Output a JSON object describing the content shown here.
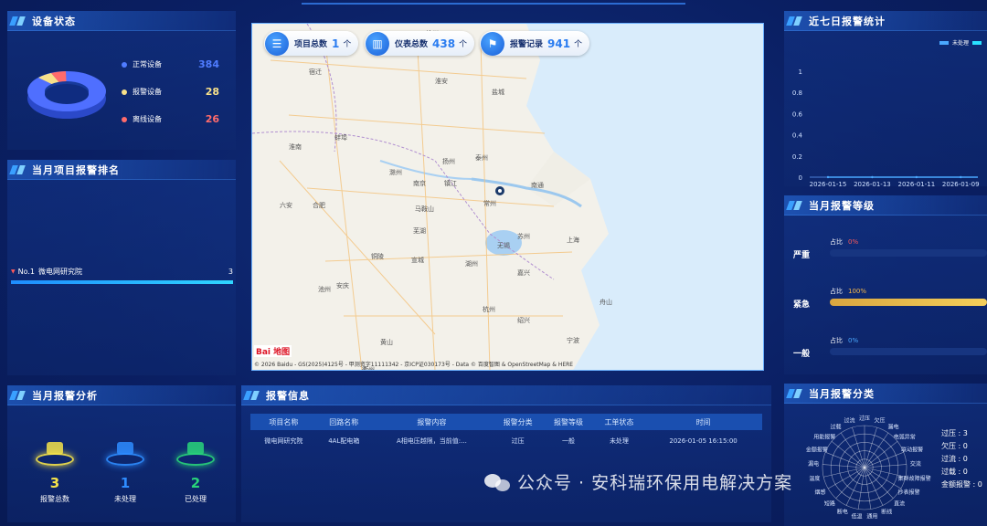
{
  "device_status": {
    "title": "设备状态",
    "items": [
      {
        "label": "正常设备",
        "value": "384",
        "color": "#4f7cff"
      },
      {
        "label": "报警设备",
        "value": "28",
        "color": "#f7e08a"
      },
      {
        "label": "离线设备",
        "value": "26",
        "color": "#ff6b6b"
      }
    ]
  },
  "project_ranking": {
    "title": "当月项目报警排名",
    "items": [
      {
        "rank": "No.1",
        "name": "微电网研究院",
        "value": "3",
        "fraction": 1.0
      }
    ]
  },
  "alarm_analysis": {
    "title": "当月报警分析",
    "items": [
      {
        "value": "3",
        "label": "报警总数",
        "color": "#f5e34a"
      },
      {
        "value": "1",
        "label": "未处理",
        "color": "#2e8cff"
      },
      {
        "value": "2",
        "label": "已处理",
        "color": "#29d37a"
      }
    ]
  },
  "map": {
    "stats": [
      {
        "label": "项目总数",
        "value": "1",
        "unit": "个",
        "icon": "list-icon"
      },
      {
        "label": "仪表总数",
        "value": "438",
        "unit": "个",
        "icon": "meter-icon"
      },
      {
        "label": "报警记录",
        "value": "941",
        "unit": "个",
        "icon": "alarm-icon"
      }
    ],
    "cities": [
      "徐州",
      "宿迁",
      "淮安",
      "盐城",
      "淮南",
      "蚌埠",
      "扬州",
      "泰州",
      "南通",
      "合肥",
      "六安",
      "滁州",
      "南京",
      "镇江",
      "常州",
      "马鞍山",
      "芜湖",
      "无锡",
      "苏州",
      "上海",
      "铜陵",
      "宣城",
      "湖州",
      "嘉兴",
      "池州",
      "安庆",
      "杭州",
      "绍兴",
      "黄山",
      "宁波",
      "衢州",
      "舟山"
    ],
    "logo": "Bai 地图",
    "copyright": "© 2026 Baidu - GS(2025)4125号 - 甲测资字11111342 - 京ICP证030173号 - Data © 百度智图 & OpenStreetMap & HERE"
  },
  "alarm_info": {
    "title": "报警信息",
    "columns": [
      "项目名称",
      "回路名称",
      "报警内容",
      "报警分类",
      "报警等级",
      "工单状态",
      "时间"
    ],
    "rows": [
      [
        "微电网研究院",
        "4AL配电箱",
        "A相电压越限，当前值:...",
        "过压",
        "一般",
        "未处理",
        "2026-01-05 16:15:00"
      ]
    ]
  },
  "weekly_stats": {
    "title": "近七日报警统计",
    "legend": [
      "未处理",
      ""
    ]
  },
  "alarm_level": {
    "title": "当月报警等级",
    "items": [
      {
        "label": "严重",
        "ratio_label": "占比",
        "percent": "0%",
        "fraction": 0,
        "pct_color": "#ff5a5a"
      },
      {
        "label": "紧急",
        "ratio_label": "占比",
        "percent": "100%",
        "fraction": 1.0,
        "pct_color": "#f5b84a"
      },
      {
        "label": "一般",
        "ratio_label": "占比",
        "percent": "0%",
        "fraction": 0,
        "pct_color": "#4aa8ff"
      }
    ]
  },
  "alarm_category": {
    "title": "当月报警分类",
    "radar_labels": [
      "过压",
      "欠压",
      "漏电",
      "电弧异常",
      "联动报警",
      "交流",
      "集群故障报警",
      "抄表报警",
      "直流",
      "断线",
      "通用",
      "低温",
      "断电",
      "短路",
      "烟感",
      "温度",
      "漏电",
      "金额报警",
      "用能报警",
      "过载",
      "过流"
    ],
    "legend": [
      {
        "label": "过压 : 3"
      },
      {
        "label": "欠压 : 0"
      },
      {
        "label": "过流 : 0"
      },
      {
        "label": "过载 : 0"
      },
      {
        "label": "金额报警 : 0"
      }
    ]
  },
  "chart_data": {
    "type": "line",
    "title": "近七日报警统计",
    "x": [
      "2026-01-15",
      "2026-01-13",
      "2026-01-11",
      "2026-01-09"
    ],
    "series": [
      {
        "name": "未处理",
        "values": [
          0,
          0,
          0,
          0
        ]
      }
    ],
    "ylim": [
      0,
      1
    ],
    "yticks": [
      "0",
      "0.2",
      "0.4",
      "0.6",
      "0.8",
      "1"
    ],
    "xlabel": "",
    "ylabel": "",
    "legend": "top-right",
    "grid": false
  },
  "watermark": "公众号 · 安科瑞环保用电解决方案",
  "colors": {
    "accent": "#3aa0ff",
    "panel": "#123a92"
  }
}
